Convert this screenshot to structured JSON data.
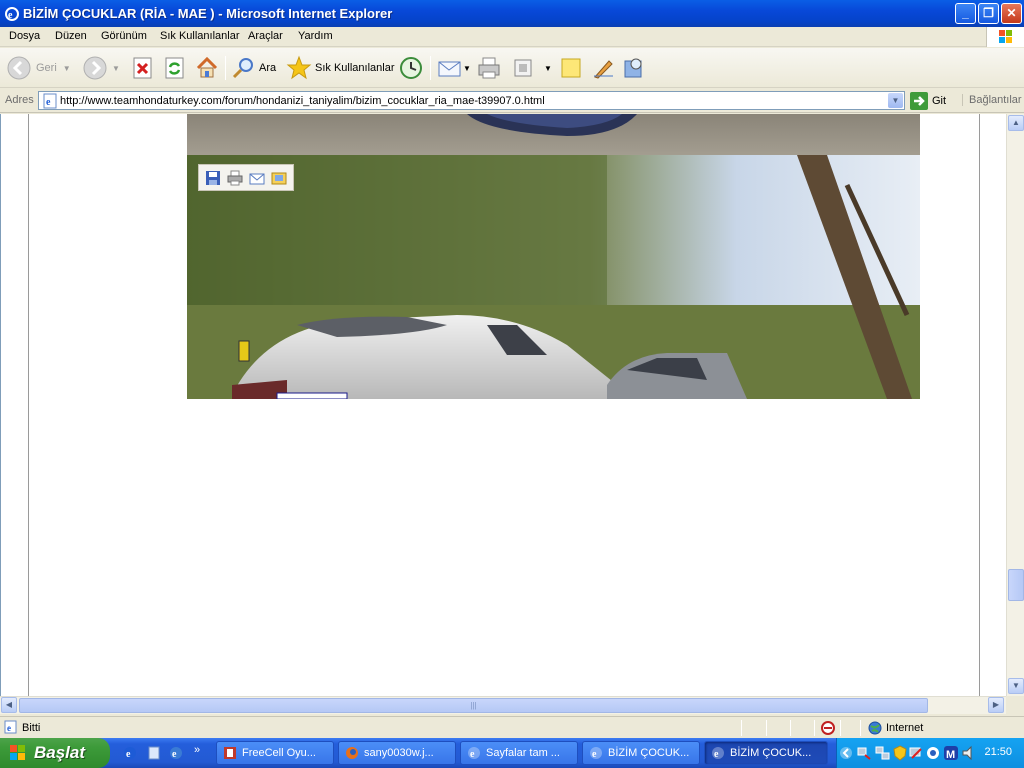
{
  "window": {
    "title": "BİZİM ÇOCUKLAR (RİA - MAE ) - Microsoft Internet Explorer"
  },
  "menu": [
    "Dosya",
    "Düzen",
    "Görünüm",
    "Sık Kullanılanlar",
    "Araçlar",
    "Yardım"
  ],
  "toolbar": {
    "back": "Geri",
    "search": "Ara",
    "favorites": "Sık Kullanılanlar"
  },
  "address": {
    "label": "Adres",
    "url": "http://www.teamhondaturkey.com/forum/hondanizi_taniyalim/bizim_cocuklar_ria_mae-t39907.0.html",
    "go": "Git",
    "links": "Bağlantılar"
  },
  "status": {
    "text": "Bitti",
    "zone": "Internet"
  },
  "taskbar": {
    "start": "Başlat",
    "tasks": [
      "FreeCell Oyu...",
      "sany0030w.j...",
      "Sayfalar tam ...",
      "BİZİM ÇOCUK...",
      "BİZİM ÇOCUK..."
    ],
    "clock": "21:50"
  }
}
